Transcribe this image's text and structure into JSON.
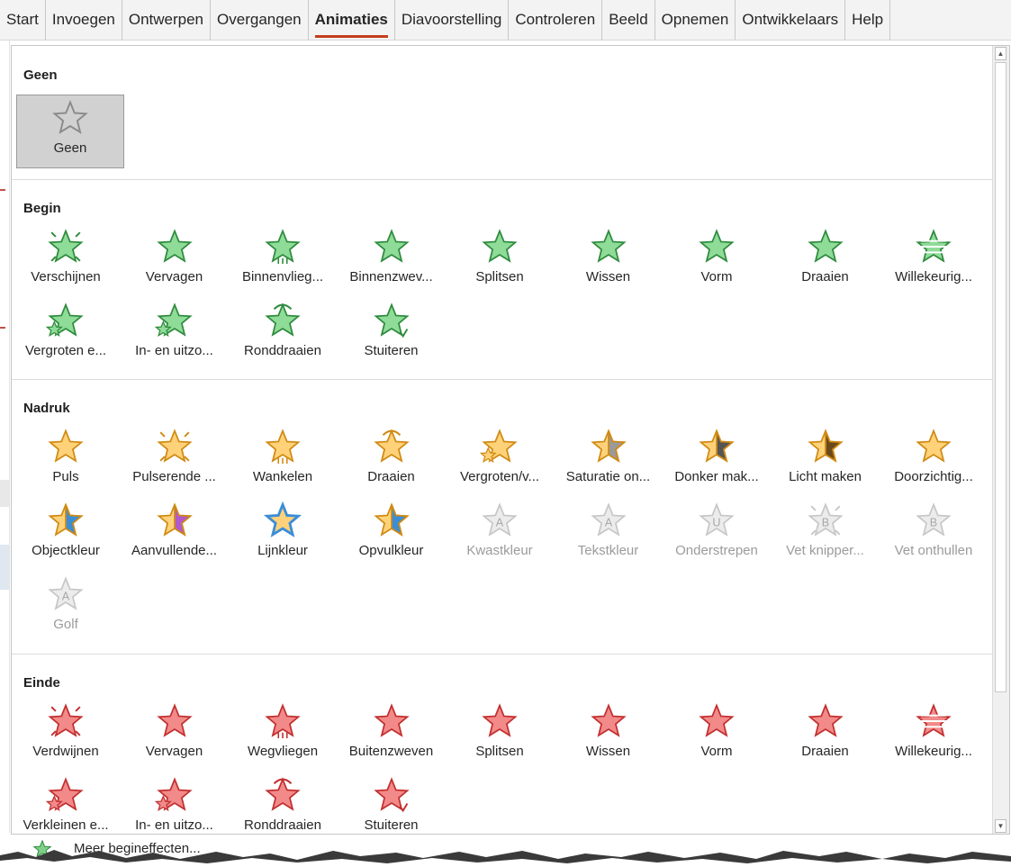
{
  "ribbon": {
    "tabs": [
      "Start",
      "Invoegen",
      "Ontwerpen",
      "Overgangen",
      "Animaties",
      "Diavoorstelling",
      "Controleren",
      "Beeld",
      "Opnemen",
      "Ontwikkelaars",
      "Help"
    ],
    "active_tab": "Animaties"
  },
  "colors": {
    "entrance": "#5cb85c",
    "emphasis": "#f0ad4e",
    "exit": "#e35b5b",
    "disabled": "#c7c7c7",
    "accent": "#c43e1c"
  },
  "sections": [
    {
      "title": "Geen",
      "items": [
        {
          "label": "Geen",
          "icon": "star-outline-icon",
          "state": "selected"
        }
      ]
    },
    {
      "title": "Begin",
      "items": [
        {
          "label": "Verschijnen",
          "icon": "appear-star-icon"
        },
        {
          "label": "Vervagen",
          "icon": "fade-star-icon"
        },
        {
          "label": "Binnenvlieg...",
          "icon": "fly-in-star-icon"
        },
        {
          "label": "Binnenzwev...",
          "icon": "float-in-star-icon"
        },
        {
          "label": "Splitsen",
          "icon": "split-star-icon"
        },
        {
          "label": "Wissen",
          "icon": "wipe-star-icon"
        },
        {
          "label": "Vorm",
          "icon": "shape-star-icon"
        },
        {
          "label": "Draaien",
          "icon": "wheel-star-icon"
        },
        {
          "label": "Willekeurig...",
          "icon": "random-bars-star-icon"
        },
        {
          "label": "Vergroten e...",
          "icon": "grow-turn-star-icon"
        },
        {
          "label": "In- en uitzo...",
          "icon": "zoom-star-icon"
        },
        {
          "label": "Ronddraaien",
          "icon": "swivel-star-icon"
        },
        {
          "label": "Stuiteren",
          "icon": "bounce-star-icon"
        }
      ]
    },
    {
      "title": "Nadruk",
      "items": [
        {
          "label": "Puls",
          "icon": "pulse-star-icon"
        },
        {
          "label": "Pulserende ...",
          "icon": "color-pulse-star-icon"
        },
        {
          "label": "Wankelen",
          "icon": "teeter-star-icon"
        },
        {
          "label": "Draaien",
          "icon": "spin-star-icon"
        },
        {
          "label": "Vergroten/v...",
          "icon": "grow-shrink-star-icon"
        },
        {
          "label": "Saturatie on...",
          "icon": "desaturate-star-icon"
        },
        {
          "label": "Donker mak...",
          "icon": "darken-star-icon"
        },
        {
          "label": "Licht maken",
          "icon": "lighten-star-icon"
        },
        {
          "label": "Doorzichtig...",
          "icon": "transparency-star-icon"
        },
        {
          "label": "Objectkleur",
          "icon": "object-color-star-icon"
        },
        {
          "label": "Aanvullende...",
          "icon": "complementary-color-star-icon"
        },
        {
          "label": "Lijnkleur",
          "icon": "line-color-star-icon"
        },
        {
          "label": "Opvulkleur",
          "icon": "fill-color-star-icon"
        },
        {
          "label": "Kwastkleur",
          "icon": "brush-color-star-icon",
          "state": "disabled"
        },
        {
          "label": "Tekstkleur",
          "icon": "font-color-star-icon",
          "state": "disabled"
        },
        {
          "label": "Onderstrepen",
          "icon": "underline-star-icon",
          "state": "disabled"
        },
        {
          "label": "Vet knipper...",
          "icon": "bold-flash-star-icon",
          "state": "disabled"
        },
        {
          "label": "Vet onthullen",
          "icon": "bold-reveal-star-icon",
          "state": "disabled"
        },
        {
          "label": "Golf",
          "icon": "wave-star-icon",
          "state": "disabled"
        }
      ]
    },
    {
      "title": "Einde",
      "items": [
        {
          "label": "Verdwijnen",
          "icon": "disappear-star-icon"
        },
        {
          "label": "Vervagen",
          "icon": "fade-out-star-icon"
        },
        {
          "label": "Wegvliegen",
          "icon": "fly-out-star-icon"
        },
        {
          "label": "Buitenzweven",
          "icon": "float-out-star-icon"
        },
        {
          "label": "Splitsen",
          "icon": "split-out-star-icon"
        },
        {
          "label": "Wissen",
          "icon": "wipe-out-star-icon"
        },
        {
          "label": "Vorm",
          "icon": "shape-out-star-icon"
        },
        {
          "label": "Draaien",
          "icon": "wheel-out-star-icon"
        },
        {
          "label": "Willekeurig...",
          "icon": "random-bars-out-star-icon"
        },
        {
          "label": "Verkleinen e...",
          "icon": "shrink-turn-star-icon"
        },
        {
          "label": "In- en uitzo...",
          "icon": "zoom-out-star-icon"
        },
        {
          "label": "Ronddraaien",
          "icon": "swivel-out-star-icon"
        },
        {
          "label": "Stuiteren",
          "icon": "bounce-out-star-icon"
        }
      ]
    }
  ],
  "footer": {
    "more_label": "Meer begineffecten...",
    "icon": "more-entrance-star-icon"
  }
}
